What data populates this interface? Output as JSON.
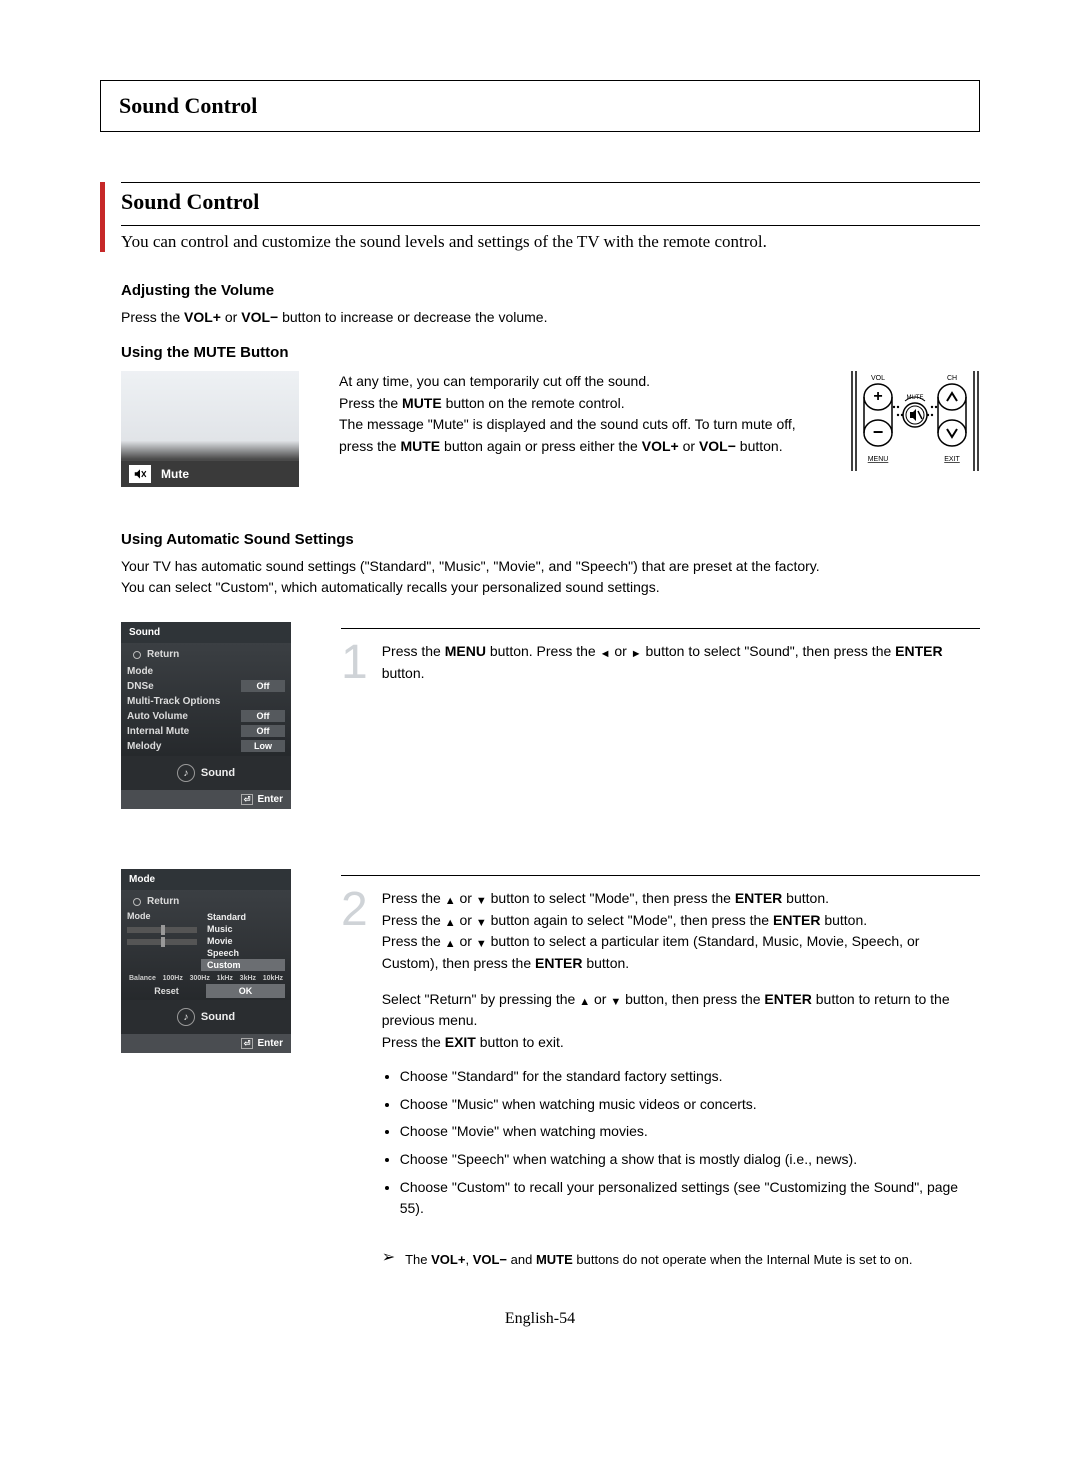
{
  "chapter_title": "Sound Control",
  "section": {
    "title": "Sound Control",
    "intro": "You can control and customize the sound levels and settings of the TV with the remote control."
  },
  "vol": {
    "heading": "Adjusting the Volume",
    "text_prefix": "Press the ",
    "vol_plus": "VOL+",
    "or": " or ",
    "vol_minus": "VOL−",
    "text_suffix": " button to increase or decrease the volume."
  },
  "mute": {
    "heading": "Using the MUTE Button",
    "fig_label": "Mute",
    "p1": "At any time, you can temporarily cut off the sound.",
    "p2a": "Press the ",
    "p2b": "MUTE",
    "p2c": " button on the remote control.",
    "p3": "The message \"Mute\" is displayed and the sound cuts off. To turn mute off, press the ",
    "p3b": "MUTE",
    "p3c": " button again or press either the ",
    "p3d": "VOL+",
    "p3e": " or ",
    "p3f": "VOL−",
    "p3g": " button."
  },
  "remote": {
    "vol_label": "VOL",
    "ch_label": "CH",
    "mute_label": "MUTE",
    "menu_label": "MENU",
    "exit_label": "EXIT"
  },
  "auto": {
    "heading": "Using Automatic Sound Settings",
    "intro1": "Your TV has automatic sound settings (\"Standard\", \"Music\", \"Movie\", and \"Speech\") that are preset at the factory.",
    "intro2": "You can select \"Custom\", which automatically recalls your personalized sound settings."
  },
  "osd1": {
    "title": "Sound",
    "return": "Return",
    "rows": [
      {
        "label": "Mode",
        "value": ""
      },
      {
        "label": "DNSe",
        "value": "Off"
      },
      {
        "label": "Multi-Track Options",
        "value": ""
      },
      {
        "label": "Auto Volume",
        "value": "Off"
      },
      {
        "label": "Internal Mute",
        "value": "Off"
      },
      {
        "label": "Melody",
        "value": "Low"
      }
    ],
    "mid": "Sound",
    "enter": "Enter"
  },
  "step1": {
    "num": "1",
    "t1": "Press the ",
    "menu": "MENU",
    "t2": " button. Press the ",
    "arrow_l": "◄",
    "t_or": " or ",
    "arrow_r": "►",
    "t3": " button to select \"Sound\", then press the ",
    "enter": "ENTER",
    "t4": " button."
  },
  "osd2": {
    "title": "Mode",
    "return": "Return",
    "mode_label": "Mode",
    "options": [
      "Standard",
      "Music",
      "Movie",
      "Speech",
      "Custom"
    ],
    "selected": "Custom",
    "eq_labels": [
      "Balance",
      "100Hz",
      "300Hz",
      "1kHz",
      "3kHz",
      "10kHz"
    ],
    "reset": "Reset",
    "ok": "OK",
    "mid": "Sound",
    "enter": "Enter"
  },
  "step2": {
    "num": "2",
    "p1a": "Press the ",
    "up": "▲",
    "or": " or ",
    "down": "▼",
    "p1b": " button to select \"Mode\", then press the ",
    "enter": "ENTER",
    "p1c": " button.",
    "p2a": "Press the ",
    "p2b": " button again to select \"Mode\", then press the ",
    "p2c": " button.",
    "p3a": "Press the ",
    "p3b": " button to select a particular item (Standard, Music, Movie, Speech, or Custom), then press the ",
    "p3c": " button.",
    "p4a": "Select \"Return\" by pressing the ",
    "p4b": " button, then press the ",
    "p4c": " button to return to the previous menu.",
    "p5a": "Press the ",
    "exit": "EXIT",
    "p5b": " button to exit.",
    "bullets": [
      "Choose \"Standard\" for the standard factory settings.",
      "Choose \"Music\" when watching music videos or concerts.",
      "Choose \"Movie\" when watching movies.",
      "Choose \"Speech\" when watching a show that is mostly dialog (i.e., news).",
      "Choose \"Custom\" to recall your personalized settings (see \"Customizing the Sound\", page 55)."
    ]
  },
  "note": {
    "glyph": "➢",
    "t1": "The ",
    "b1": "VOL+",
    "t2": ", ",
    "b2": "VOL−",
    "t3": " and ",
    "b3": "MUTE",
    "t4": " buttons do not operate when the Internal Mute is set to on."
  },
  "footer": "English-54"
}
